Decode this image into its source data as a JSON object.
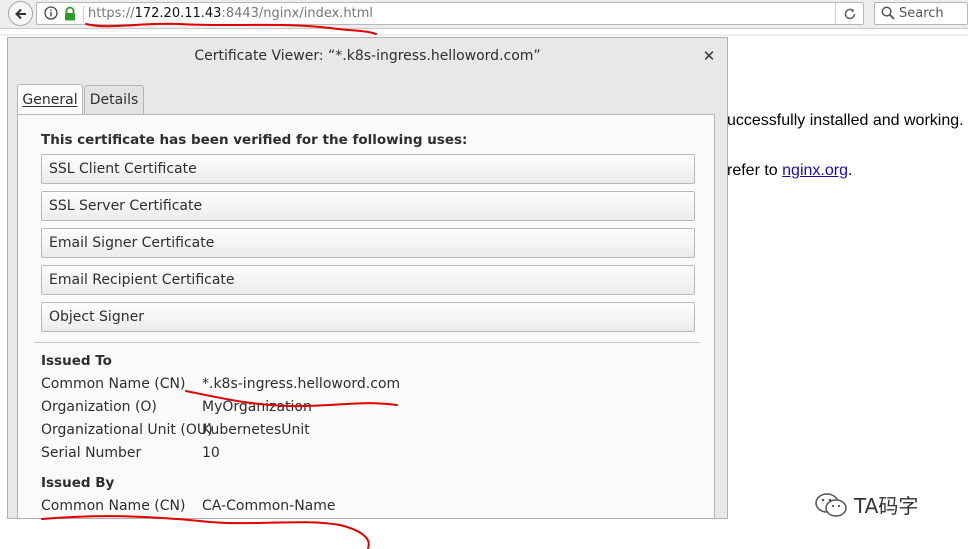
{
  "browser": {
    "url_scheme": "https://",
    "url_host": "172.20.11.43",
    "url_rest": ":8443/nginx/index.html",
    "search_placeholder": "Search"
  },
  "page": {
    "line1": "uccessfully installed and working.",
    "line2_prefix": "refer to ",
    "line2_link": "nginx.org",
    "line2_suffix": "."
  },
  "dialog": {
    "title": "Certificate Viewer: “*.k8s-ingress.helloword.com”",
    "tabs": [
      "General",
      "Details"
    ],
    "uses_heading": "This certificate has been verified for the following uses:",
    "uses": [
      "SSL Client Certificate",
      "SSL Server Certificate",
      "Email Signer Certificate",
      "Email Recipient Certificate",
      "Object Signer"
    ],
    "issued_to": {
      "heading": "Issued To",
      "fields": [
        {
          "label": "Common Name (CN)",
          "value": "*.k8s-ingress.helloword.com"
        },
        {
          "label": "Organization (O)",
          "value": "MyOrganization"
        },
        {
          "label": "Organizational Unit (OU)",
          "value": "KubernetesUnit"
        },
        {
          "label": "Serial Number",
          "value": "10"
        }
      ]
    },
    "issued_by": {
      "heading": "Issued By",
      "fields": [
        {
          "label": "Common Name (CN)",
          "value": "CA-Common-Name"
        }
      ]
    }
  },
  "watermark": {
    "text": "TA码字"
  },
  "colors": {
    "annotation": "#e00000",
    "link": "#1a0dab"
  }
}
